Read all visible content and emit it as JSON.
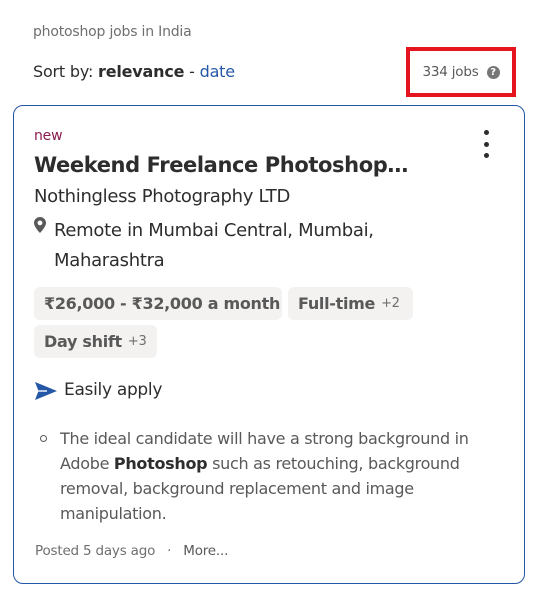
{
  "search": {
    "caption": "photoshop jobs in India"
  },
  "sort": {
    "prefix": "Sort by:",
    "active": "relevance",
    "separator": "-",
    "alternative": "date"
  },
  "results": {
    "count_label": "334 jobs",
    "help_glyph": "?"
  },
  "job": {
    "badge": "new",
    "title": "Weekend Freelance Photoshop…",
    "company": "Nothingless Photography LTD",
    "location_line1": "Remote in Mumbai Central, Mumbai,",
    "location_line2": "Maharashtra",
    "tags": {
      "salary": "₹26,000 - ₹32,000 a month",
      "job_type": "Full-time",
      "job_type_more": "+2",
      "shift": "Day shift",
      "shift_more": "+3"
    },
    "apply_label": "Easily apply",
    "snippet": {
      "before": "The ideal candidate will have a strong background in Adobe ",
      "highlight": "Photoshop",
      "after": " such as retouching, background removal, background replacement and image manipulation."
    },
    "posted": "Posted 5 days ago",
    "footer_separator": "·",
    "more_label": "More..."
  },
  "colors": {
    "link": "#2557a7",
    "card_border": "#2557a7",
    "highlight_box": "#e4151f",
    "new_badge": "#8a1a4e"
  },
  "icons": [
    "help-icon",
    "kebab-menu-icon",
    "location-pin-icon",
    "send-arrow-icon"
  ]
}
